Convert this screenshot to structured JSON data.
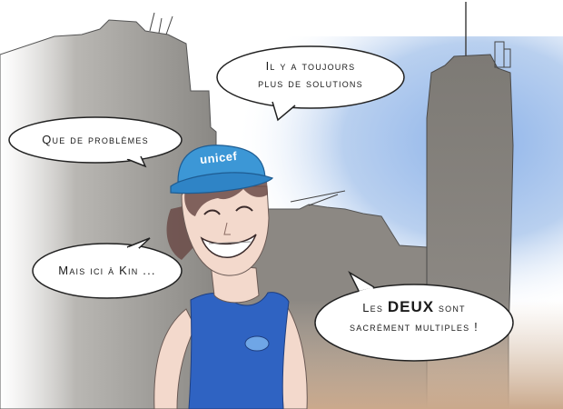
{
  "scene": {
    "colors": {
      "sky": "#a7c4ea",
      "building_left": "#8a8884",
      "building_right": "#7f7c77",
      "cap": "#3c97d6",
      "shirt": "#2f63c2",
      "skin": "#f3d9cc",
      "hair": "#6b4b48"
    },
    "cap_logo": "unicef"
  },
  "bubbles": {
    "top": {
      "line1": "Il y a toujours",
      "line2": "plus de solutions"
    },
    "left": {
      "text": "Que de problèmes"
    },
    "middle": {
      "text": "Mais ici à Kin ..."
    },
    "bottom": {
      "line1_a": "Les ",
      "line1_emph": "DEUX",
      "line1_b": " sont",
      "line2": "sacrément multiples !"
    }
  }
}
